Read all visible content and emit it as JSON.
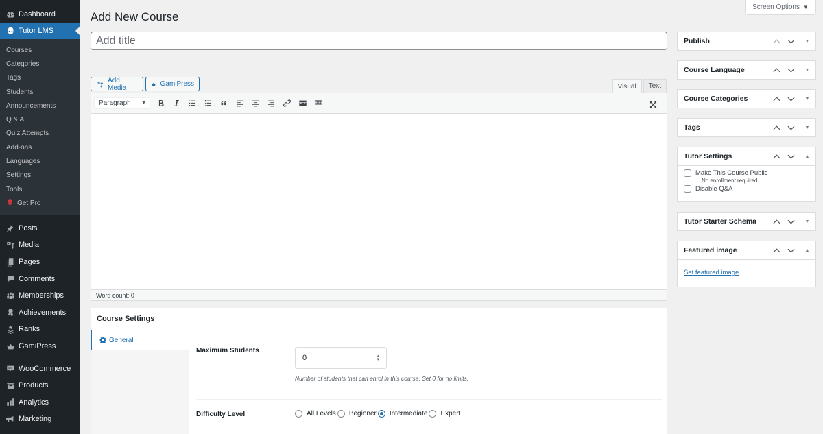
{
  "sidebar": {
    "top_items": [
      {
        "label": "Dashboard",
        "icon": "dashboard-icon"
      },
      {
        "label": "Tutor LMS",
        "icon": "tutor-lms-icon",
        "current": true
      }
    ],
    "tutor_submenu": [
      "Courses",
      "Categories",
      "Tags",
      "Students",
      "Announcements",
      "Q & A",
      "Quiz Attempts",
      "Add-ons",
      "Languages",
      "Settings",
      "Tools",
      "Get Pro"
    ],
    "group1": [
      {
        "label": "Posts",
        "icon": "pin-icon"
      },
      {
        "label": "Media",
        "icon": "media-icon"
      },
      {
        "label": "Pages",
        "icon": "pages-icon"
      },
      {
        "label": "Comments",
        "icon": "comment-icon"
      },
      {
        "label": "Memberships",
        "icon": "groups-icon"
      },
      {
        "label": "Achievements",
        "icon": "award-icon"
      },
      {
        "label": "Ranks",
        "icon": "rank-icon"
      },
      {
        "label": "GamiPress",
        "icon": "crown-icon"
      }
    ],
    "group2": [
      {
        "label": "WooCommerce",
        "icon": "woo-icon"
      },
      {
        "label": "Products",
        "icon": "archive-icon"
      },
      {
        "label": "Analytics",
        "icon": "chart-bar-icon"
      },
      {
        "label": "Marketing",
        "icon": "megaphone-icon"
      }
    ]
  },
  "header": {
    "title": "Add New Course",
    "screen_options": "Screen Options"
  },
  "title_field": {
    "placeholder": "Add title",
    "value": ""
  },
  "media_buttons": {
    "add_media": "Add Media",
    "gamipress": "GamiPress"
  },
  "editor": {
    "tabs": [
      {
        "label": "Visual",
        "active": true
      },
      {
        "label": "Text",
        "active": false
      }
    ],
    "format_select": "Paragraph",
    "toolbar_buttons": [
      "bold",
      "italic",
      "bulleted-list",
      "numbered-list",
      "blockquote",
      "align-left",
      "align-center",
      "align-right",
      "insert-link",
      "read-more",
      "toolbar-toggle"
    ],
    "word_count": "Word count: 0"
  },
  "course_settings": {
    "title": "Course Settings",
    "tabs": [
      {
        "label": "General",
        "active": true
      }
    ],
    "max_students": {
      "label": "Maximum Students",
      "value": "0",
      "help": "Number of students that can enrol in this course. Set 0 for no limits."
    },
    "difficulty": {
      "label": "Difficulty Level",
      "options": [
        "All Levels",
        "Beginner",
        "Intermediate",
        "Expert"
      ],
      "selected": "Intermediate"
    }
  },
  "metaboxes": {
    "publish": "Publish",
    "course_language": "Course Language",
    "course_categories": "Course Categories",
    "tags": "Tags",
    "tutor_settings": {
      "title": "Tutor Settings",
      "public_label": "Make This Course Public",
      "public_desc": "No enrollment required.",
      "disable_qa": "Disable Q&A"
    },
    "tutor_starter_schema": "Tutor Starter Schema",
    "featured_image": {
      "title": "Featured image",
      "link": "Set featured image"
    }
  },
  "colors": {
    "accent": "#2271b1",
    "sidebar_bg": "#1d2327",
    "submenu_bg": "#2c3338",
    "page_bg": "#f0f0f1"
  }
}
